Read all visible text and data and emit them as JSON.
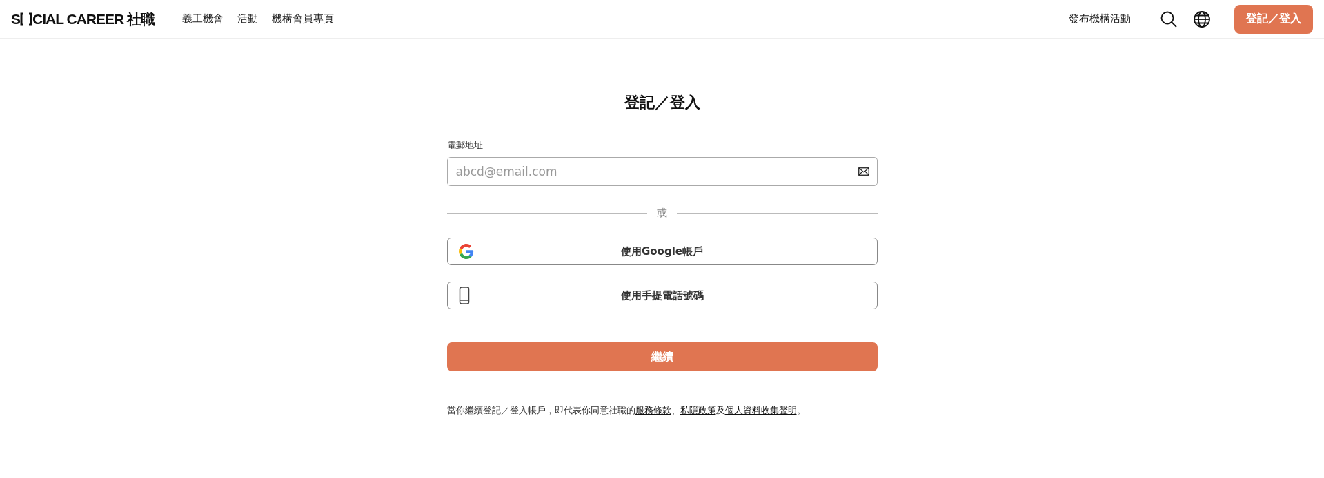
{
  "header": {
    "logo": {
      "before": "S",
      "after": "CIAL CAREER 社職"
    },
    "nav": [
      {
        "label": "義工機會"
      },
      {
        "label": "活動"
      },
      {
        "label": "機構會員專頁"
      }
    ],
    "post_event": "發布機構活動",
    "login_button": "登記／登入"
  },
  "form": {
    "title": "登記／登入",
    "email": {
      "label": "電郵地址",
      "placeholder": "abcd@email.com"
    },
    "divider": "或",
    "providers": [
      {
        "kind": "google",
        "label": "使用Google帳戶"
      },
      {
        "kind": "phone",
        "label": "使用手提電話號碼"
      }
    ],
    "continue": "繼續",
    "terms": [
      {
        "kind": "text",
        "text": "當你繼續登記／登入帳戶，即代表你同意社職的"
      },
      {
        "kind": "link",
        "text": "服務條款"
      },
      {
        "kind": "text",
        "text": "、"
      },
      {
        "kind": "link",
        "text": "私隱政策"
      },
      {
        "kind": "text",
        "text": "及"
      },
      {
        "kind": "link",
        "text": "個人資料收集聲明"
      },
      {
        "kind": "text",
        "text": "。"
      }
    ]
  }
}
